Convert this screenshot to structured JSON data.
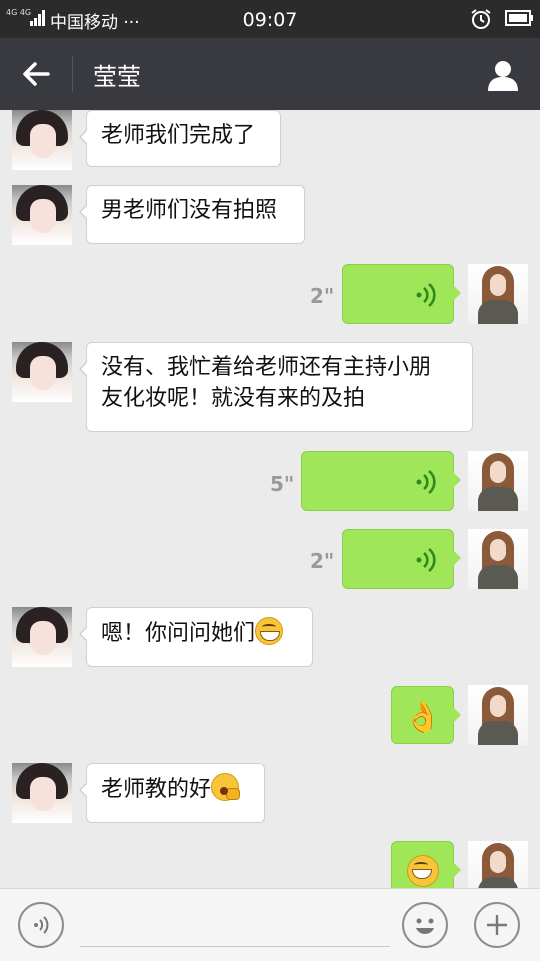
{
  "status_bar": {
    "network": "4G 4G",
    "carrier": "中国移动 ···",
    "time": "09:07"
  },
  "header": {
    "title": "莹莹",
    "back_icon": "arrow-left-icon",
    "profile_icon": "person-icon"
  },
  "messages": [
    {
      "side": "left",
      "type": "text",
      "text": "老师我们完成了"
    },
    {
      "side": "left",
      "type": "text",
      "text": "男老师们没有拍照"
    },
    {
      "side": "right",
      "type": "voice",
      "duration": "2\""
    },
    {
      "side": "left",
      "type": "text",
      "text": "没有、我忙着给老师还有主持小朋\n友化妆呢！就没有来的及拍"
    },
    {
      "side": "right",
      "type": "voice",
      "duration": "5\""
    },
    {
      "side": "right",
      "type": "voice",
      "duration": "2\""
    },
    {
      "side": "left",
      "type": "text",
      "text": "嗯！你问问她们",
      "emoji": "grin-emoji"
    },
    {
      "side": "right",
      "type": "emoji",
      "emoji": "ok-hand-emoji"
    },
    {
      "side": "left",
      "type": "text",
      "text": "老师教的好",
      "emoji": "yawn-emoji"
    },
    {
      "side": "right",
      "type": "emoji",
      "emoji": "grin-emoji"
    }
  ],
  "input_bar": {
    "voice_icon": "voice-icon",
    "emoji_icon": "smiley-icon",
    "plus_icon": "plus-icon"
  },
  "colors": {
    "header": "#393a3f",
    "status_bar": "#2b2b2b",
    "chat_bg": "#ebebeb",
    "sent_bubble": "#9fe658",
    "received_bubble": "#ffffff"
  }
}
